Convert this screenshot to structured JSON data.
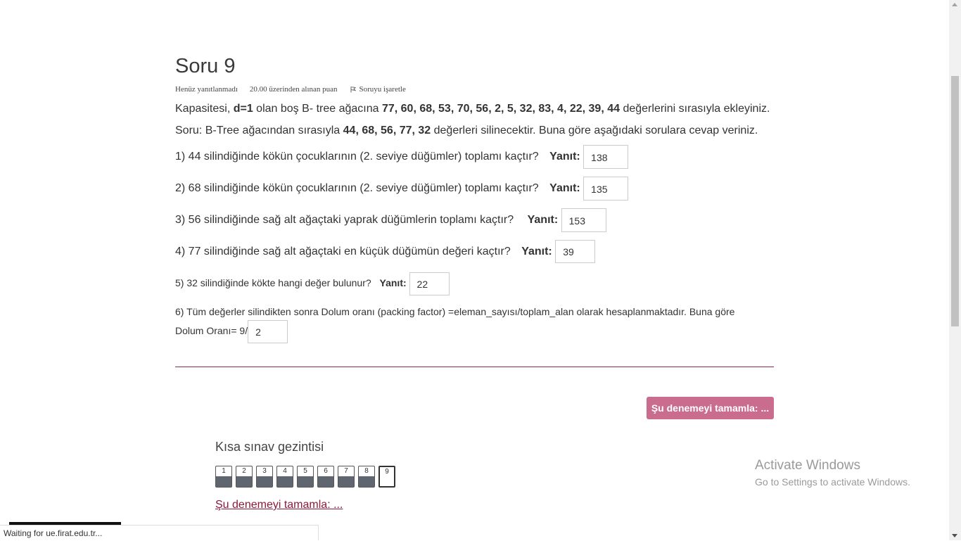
{
  "question": {
    "title": "Soru 9",
    "status": "Henüz yanıtlanmadı",
    "points": "20.00 üzerinden alınan puan",
    "flag_label": "Soruyu işaretle"
  },
  "intro": {
    "a1": "Kapasitesi, ",
    "a2": "d=1",
    "a3": " olan boş B- tree ağacına  ",
    "a4": "77, 60, 68, 53,  70, 56, 2, 5, 32, 83, 4, 22, 39, 44",
    "a5": " değerlerini sırasıyla ekleyiniz.",
    "b1": "Soru: B-Tree ağacından sırasıyla ",
    "b2": "44, 68, 56, 77, 32",
    "b3": " değerleri silinecektir. Buna göre aşağıdaki sorulara cevap veriniz."
  },
  "answer_label": "Yanıt:",
  "items": [
    {
      "text": "1) 44 silindiğinde kökün çocuklarının (2. seviye düğümler) toplamı kaçtır?",
      "value": "138"
    },
    {
      "text": "2) 68 silindiğinde kökün çocuklarının (2. seviye düğümler) toplamı kaçtır?",
      "value": "135"
    },
    {
      "text": "3) 56 silindiğinde sağ alt ağaçtaki yaprak düğümlerin toplamı kaçtır?",
      "value": "153"
    },
    {
      "text": "4) 77 silindiğinde sağ alt ağaçtaki en küçük düğümün değeri kaçtır?",
      "value": "39"
    },
    {
      "text": "5) 32 silindiğinde kökte hangi değer bulunur?",
      "value": "22"
    }
  ],
  "q6": {
    "line1": "6) Tüm değerler silindikten sonra Dolum oranı (packing factor) =eleman_sayısı/toplam_alan olarak hesaplanmaktadır. Buna göre",
    "line2": "Dolum Oranı= 9/",
    "value": "2"
  },
  "finish_button": "Şu denemeyi tamamla: ...",
  "navigation": {
    "title": "Kısa sınav gezintisi",
    "buttons": [
      "1",
      "2",
      "3",
      "4",
      "5",
      "6",
      "7",
      "8",
      "9"
    ],
    "current": "9",
    "finish_link": "Şu denemeyi tamamla: ..."
  },
  "watermark": {
    "line1": "Activate Windows",
    "line2": "Go to Settings to activate Windows."
  },
  "statusbar": "Waiting for ue.firat.edu.tr...",
  "colors": {
    "accent": "#8b1a3b",
    "button": "#c1537a",
    "nav_fill": "#5f6670"
  }
}
